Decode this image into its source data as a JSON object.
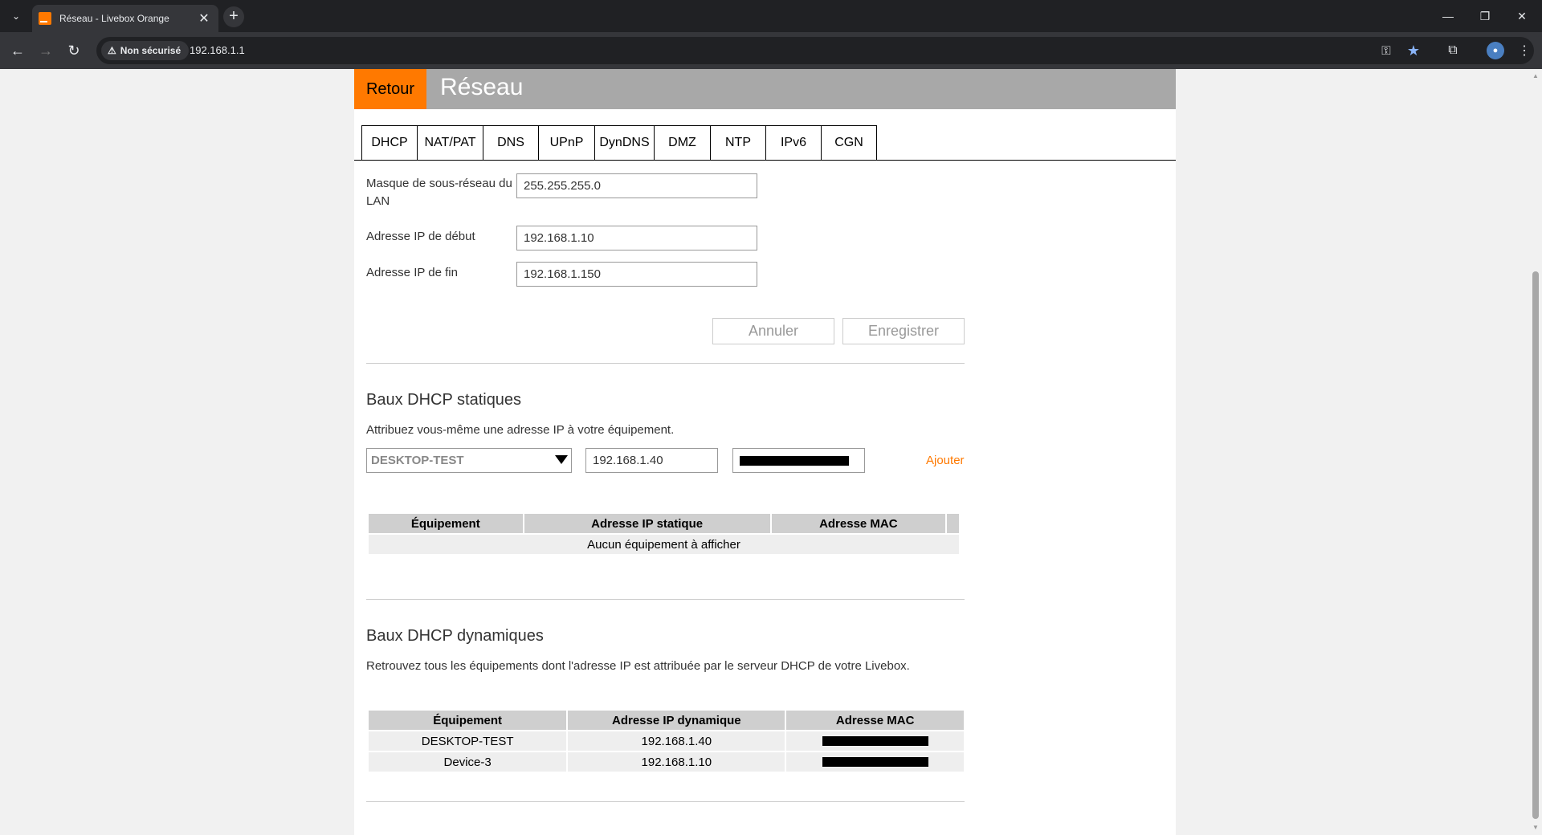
{
  "browser": {
    "tab_title": "Réseau - Livebox Orange",
    "tab_close": "✕",
    "new_tab": "+",
    "security_label": "Non sécurisé",
    "url": "192.168.1.1",
    "icons": [
      "tab-list-icon",
      "back-icon",
      "forward-icon",
      "reload-icon",
      "warning-icon",
      "key-icon",
      "star-icon",
      "extensions-icon",
      "profile-icon",
      "menu-icon",
      "minimize-icon",
      "restore-icon",
      "close-icon"
    ]
  },
  "header": {
    "back_label": "Retour",
    "title": "Réseau",
    "accent_color": "#ff7900",
    "bar_color": "#a8a8a8"
  },
  "tabs": [
    {
      "label": "DHCP",
      "active": true
    },
    {
      "label": "NAT/PAT"
    },
    {
      "label": "DNS"
    },
    {
      "label": "UPnP"
    },
    {
      "label": "DynDNS"
    },
    {
      "label": "DMZ"
    },
    {
      "label": "NTP"
    },
    {
      "label": "IPv6"
    },
    {
      "label": "CGN"
    }
  ],
  "dhcp_form": {
    "subnet_label": "Masque de sous-réseau du LAN",
    "subnet_value": "255.255.255.0",
    "start_label": "Adresse IP de début",
    "start_value": "192.168.1.10",
    "end_label": "Adresse IP de fin",
    "end_value": "192.168.1.150",
    "cancel_label": "Annuler",
    "save_label": "Enregistrer"
  },
  "static_leases": {
    "title": "Baux DHCP statiques",
    "description": "Attribuez vous-même une adresse IP à votre équipement.",
    "device_selected": "DESKTOP-TEST",
    "ip_value": "192.168.1.40",
    "add_label": "Ajouter",
    "columns": [
      "Équipement",
      "Adresse IP statique",
      "Adresse MAC"
    ],
    "empty_message": "Aucun équipement à afficher"
  },
  "dynamic_leases": {
    "title": "Baux DHCP dynamiques",
    "description": "Retrouvez tous les équipements dont l'adresse IP est attribuée par le serveur DHCP de votre Livebox.",
    "columns": [
      "Équipement",
      "Adresse IP dynamique",
      "Adresse MAC"
    ],
    "rows": [
      {
        "device": "DESKTOP-TEST",
        "ip": "192.168.1.40"
      },
      {
        "device": "Device-3",
        "ip": "192.168.1.10"
      }
    ]
  }
}
